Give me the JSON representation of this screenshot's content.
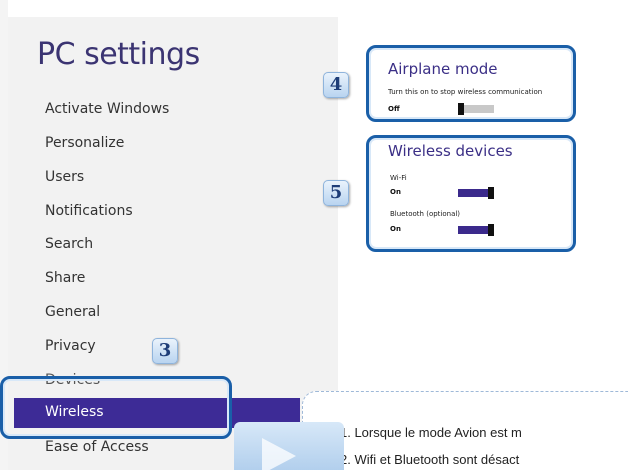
{
  "window": {
    "title": "PC settings"
  },
  "nav": {
    "items": [
      {
        "label": "Activate Windows"
      },
      {
        "label": "Personalize"
      },
      {
        "label": "Users"
      },
      {
        "label": "Notifications"
      },
      {
        "label": "Search"
      },
      {
        "label": "Share"
      },
      {
        "label": "General"
      },
      {
        "label": "Privacy"
      },
      {
        "label": "Devices"
      },
      {
        "label": "Wireless",
        "selected": true
      },
      {
        "label": "Ease of Access"
      }
    ]
  },
  "airplane": {
    "title": "Airplane mode",
    "description": "Turn this on to stop wireless communication",
    "state": "Off",
    "on": false
  },
  "wireless": {
    "title": "Wireless devices",
    "wifi": {
      "label": "Wi-Fi",
      "state": "On",
      "on": true
    },
    "bluetooth": {
      "label": "Bluetooth (optional)",
      "state": "On",
      "on": true
    }
  },
  "badges": {
    "b3": "3",
    "b4": "4",
    "b5": "5"
  },
  "callout": {
    "line1": "1.  Lorsque le mode Avion est m",
    "line2": "2.  Wifi et Bluetooth sont désact"
  },
  "colors": {
    "accent": "#3d2b96",
    "highlight": "#1a5fa8",
    "title": "#3b3472"
  },
  "icons": {
    "play": "play-icon"
  }
}
